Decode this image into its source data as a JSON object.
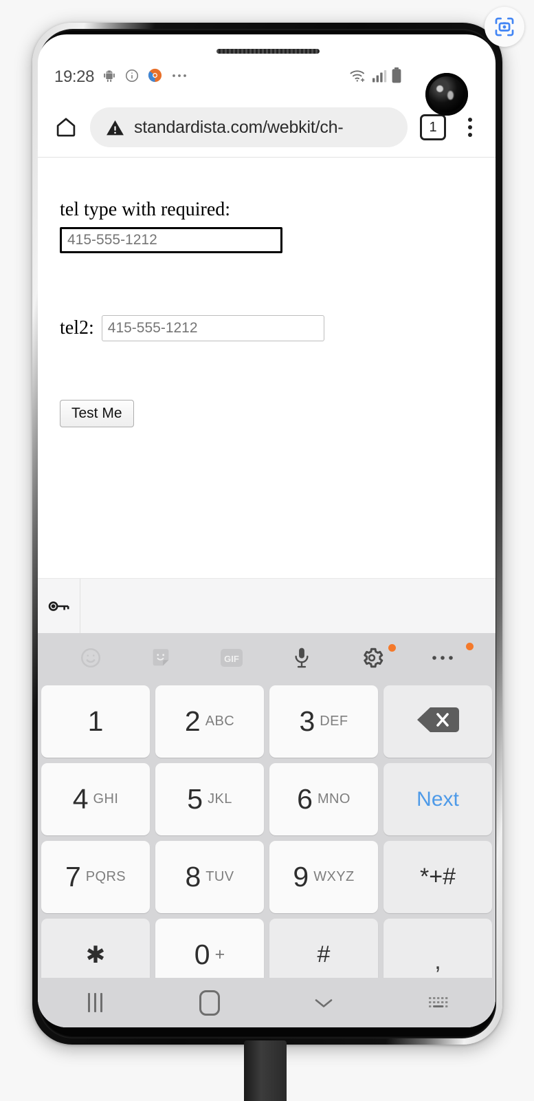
{
  "status_bar": {
    "clock": "19:28",
    "left_icons": [
      "android-robot-icon",
      "info-circle-icon",
      "app-badge-icon",
      "more-notifications-icon"
    ],
    "right_icons": [
      "wifi-icon",
      "cellular-signal-icon",
      "battery-icon"
    ]
  },
  "browser": {
    "home_icon": "home-icon",
    "security_icon": "warning-triangle-icon",
    "url": "standardista.com/webkit/ch-",
    "tab_count": "1",
    "menu_icon": "three-dot-menu-icon"
  },
  "page": {
    "tel_label_1": "tel type with required:",
    "tel_placeholder_1": "415-555-1212",
    "tel_label_2": "tel2:",
    "tel_placeholder_2": "415-555-1212",
    "submit_label": "Test Me"
  },
  "autofill": {
    "key_icon": "key-icon"
  },
  "keyboard_toolbar": {
    "items": [
      {
        "icon": "emoji-smiley-icon",
        "badge": false
      },
      {
        "icon": "sticker-icon",
        "badge": false
      },
      {
        "icon": "gif-icon",
        "badge": false,
        "label": "GIF"
      },
      {
        "icon": "microphone-icon",
        "badge": false
      },
      {
        "icon": "settings-gear-icon",
        "badge": true
      },
      {
        "icon": "overflow-dots-icon",
        "badge": true
      }
    ],
    "badge_color": "#f4792b"
  },
  "keyboard": {
    "rows": [
      [
        {
          "num": "1",
          "letters": "",
          "type": "number"
        },
        {
          "num": "2",
          "letters": "ABC",
          "type": "number"
        },
        {
          "num": "3",
          "letters": "DEF",
          "type": "number"
        },
        {
          "num": "",
          "letters": "",
          "type": "backspace",
          "icon": "backspace-icon"
        }
      ],
      [
        {
          "num": "4",
          "letters": "GHI",
          "type": "number"
        },
        {
          "num": "5",
          "letters": "JKL",
          "type": "number"
        },
        {
          "num": "6",
          "letters": "MNO",
          "type": "number"
        },
        {
          "num": "",
          "letters": "",
          "type": "action",
          "action_label": "Next"
        }
      ],
      [
        {
          "num": "7",
          "letters": "PQRS",
          "type": "number"
        },
        {
          "num": "8",
          "letters": "TUV",
          "type": "number"
        },
        {
          "num": "9",
          "letters": "WXYZ",
          "type": "number"
        },
        {
          "num": "",
          "letters": "",
          "type": "symbol",
          "symbol": "*+#"
        }
      ],
      [
        {
          "num": "",
          "letters": "",
          "type": "symbol",
          "symbol": "✱"
        },
        {
          "num": "0",
          "letters": "",
          "type": "number",
          "symbol_small": "+"
        },
        {
          "num": "",
          "letters": "",
          "type": "symbol",
          "symbol": "#"
        },
        {
          "num": "",
          "letters": "",
          "type": "comma",
          "symbol": ","
        }
      ]
    ],
    "action_color": "#4e9ae8"
  },
  "nav_bar": {
    "recent_icon": "recent-apps-icon",
    "home_icon": "home-square-icon",
    "hide_keyboard_icon": "chevron-down-icon",
    "keyboard_switch_icon": "keyboard-switch-icon"
  },
  "overlay": {
    "scan_icon": "scan-camera-icon",
    "scan_color": "#4285f4"
  }
}
